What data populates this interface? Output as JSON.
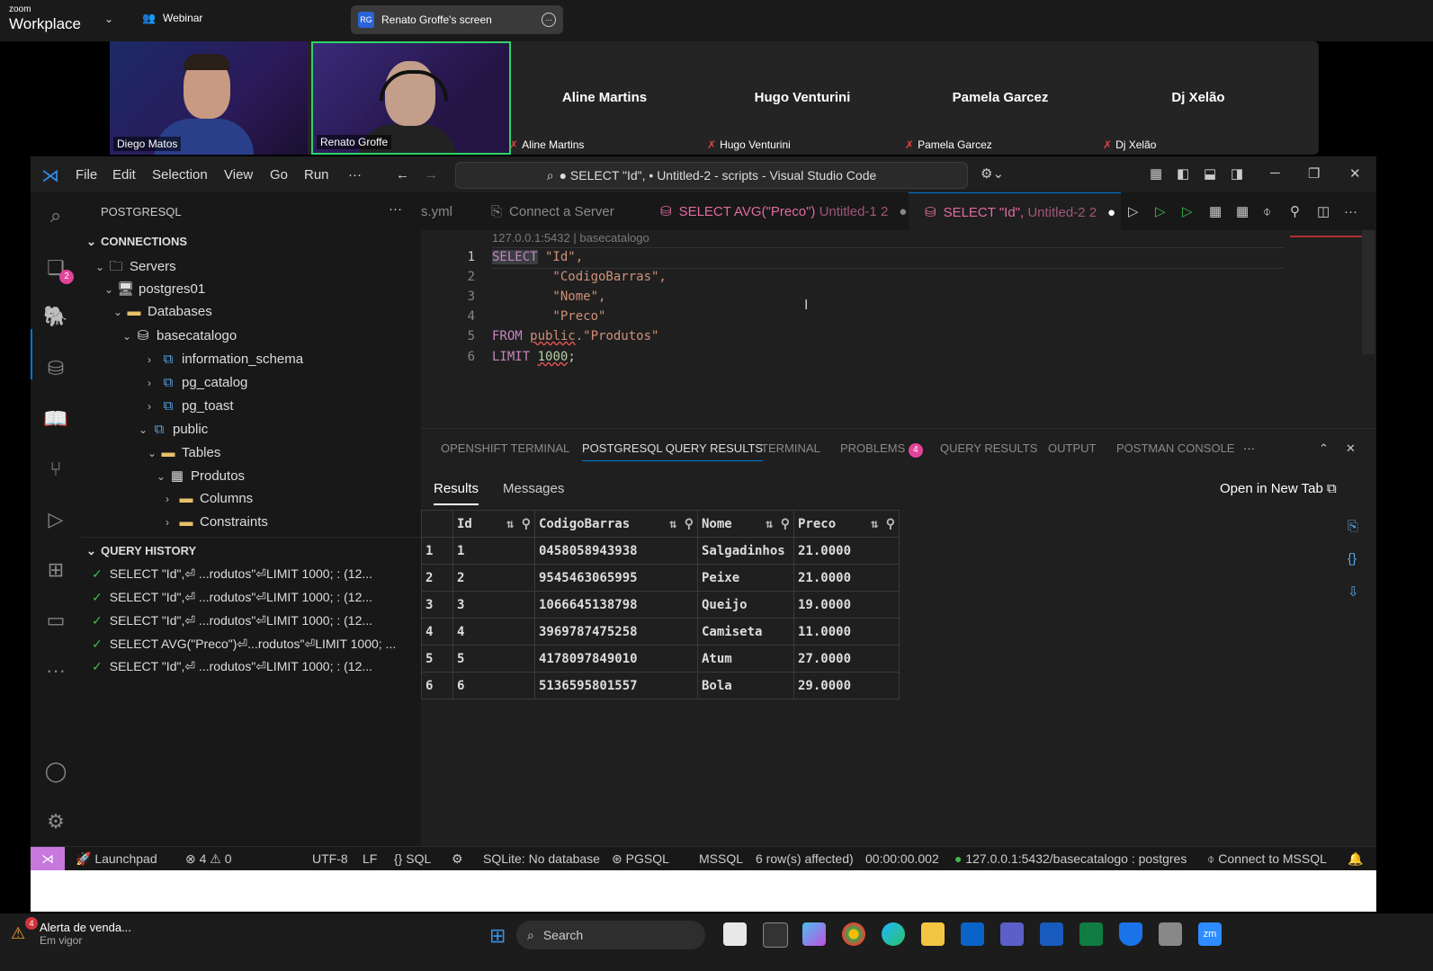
{
  "zoom": {
    "logo_small": "zoom",
    "logo_big": "Workplace",
    "webinar_label": "Webinar",
    "screen_initials": "RG",
    "screen_label": "Renato Groffe's screen"
  },
  "participants": {
    "video": [
      {
        "name": "Diego Matos"
      },
      {
        "name": "Renato Groffe"
      }
    ],
    "tiles": [
      {
        "name": "Aline Martins",
        "label": "Aline Martins"
      },
      {
        "name": "Hugo Venturini",
        "label": "Hugo Venturini"
      },
      {
        "name": "Pamela Garcez",
        "label": "Pamela Garcez"
      },
      {
        "name": "Dj Xelão",
        "label": "Dj Xelão"
      }
    ]
  },
  "vscode": {
    "menu": [
      "File",
      "Edit",
      "Selection",
      "View",
      "Go",
      "Run",
      "···"
    ],
    "title": "● SELECT \"Id\", • Untitled-2 - scripts - Visual Studio Code",
    "activity_badge": "2",
    "sidebar": {
      "header": "POSTGRESQL",
      "connections_title": "CONNECTIONS",
      "tree": [
        "Servers",
        "postgres01",
        "Databases",
        "basecatalogo",
        "information_schema",
        "pg_catalog",
        "pg_toast",
        "public",
        "Tables",
        "Produtos",
        "Columns",
        "Constraints"
      ],
      "history_title": "QUERY HISTORY",
      "history": [
        "SELECT \"Id\",⏎    ...rodutos\"⏎LIMIT 1000; : (12...",
        "SELECT \"Id\",⏎    ...rodutos\"⏎LIMIT 1000; : (12...",
        "SELECT \"Id\",⏎    ...rodutos\"⏎LIMIT 1000; : (12...",
        "SELECT AVG(\"Preco\")⏎...rodutos\"⏎LIMIT 1000; ...",
        "SELECT \"Id\",⏎    ...rodutos\"⏎LIMIT 1000; : (12..."
      ]
    },
    "tabs": {
      "yml": "s.yml",
      "connect": "Connect a Server",
      "avg_title": "SELECT AVG(\"Preco\")",
      "avg_file": "Untitled-1",
      "avg_count": "2",
      "id_title": "SELECT \"Id\",",
      "id_file": "Untitled-2",
      "id_count": "2"
    },
    "editor": {
      "connection": "127.0.0.1:5432 | basecatalogo",
      "line_numbers": [
        "1",
        "2",
        "3",
        "4",
        "5",
        "6"
      ],
      "lines": {
        "l1_kw": "SELECT",
        "l1_rest": " \"Id\",",
        "l2": "        \"CodigoBarras\",",
        "l3": "        \"Nome\",",
        "l4": "        \"Preco\"",
        "l5_kw": "FROM",
        "l5_schema": "public",
        "l5_rest": ".\"Produtos\"",
        "l6_kw": "LIMIT",
        "l6_num": "1000",
        "l6_end": ";"
      }
    },
    "panel": {
      "tabs": [
        "OPENSHIFT TERMINAL",
        "POSTGRESQL QUERY RESULTS",
        "TERMINAL",
        "PROBLEMS",
        "QUERY RESULTS",
        "OUTPUT",
        "POSTMAN CONSOLE",
        "···"
      ],
      "problems_badge": "4",
      "result_tabs": [
        "Results",
        "Messages"
      ],
      "open_new_tab": "Open in New Tab",
      "columns": [
        "Id",
        "CodigoBarras",
        "Nome",
        "Preco"
      ],
      "rows": [
        [
          "1",
          "1",
          "0458058943938",
          "Salgadinhos",
          "21.0000"
        ],
        [
          "2",
          "2",
          "9545463065995",
          "Peixe",
          "21.0000"
        ],
        [
          "3",
          "3",
          "1066645138798",
          "Queijo",
          "19.0000"
        ],
        [
          "4",
          "4",
          "3969787475258",
          "Camiseta",
          "11.0000"
        ],
        [
          "5",
          "5",
          "4178097849010",
          "Atum",
          "27.0000"
        ],
        [
          "6",
          "6",
          "5136595801557",
          "Bola",
          "29.0000"
        ]
      ]
    },
    "status": {
      "launchpad": "Launchpad",
      "problems": "⊗ 4 ⚠ 0",
      "encoding": "UTF-8",
      "eol": "LF",
      "lang": "SQL",
      "sqlite": "SQLite: No database",
      "pgsql": "PGSQL",
      "mssql": "MSSQL",
      "rows": "6 row(s) affected)",
      "time": "00:00:00.002",
      "connection": "127.0.0.1:5432/basecatalogo : postgres",
      "connect_mssql": "Connect to MSSQL"
    }
  },
  "taskbar": {
    "alert_title": "Alerta de venda...",
    "alert_sub": "Em vigor",
    "alert_badge": "4",
    "search": "Search"
  }
}
